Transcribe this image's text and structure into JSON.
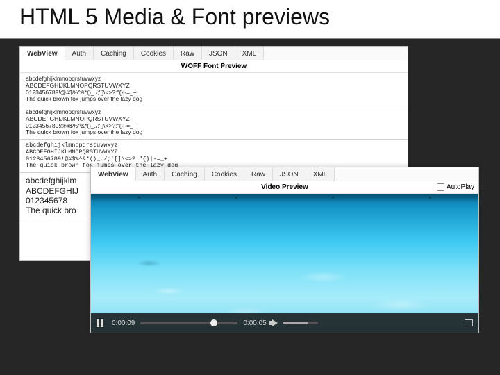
{
  "slide": {
    "title": "HTML 5 Media & Font previews"
  },
  "fontPanel": {
    "tabs": [
      "WebView",
      "Auth",
      "Caching",
      "Cookies",
      "Raw",
      "JSON",
      "XML"
    ],
    "activeTab": 0,
    "title": "WOFF Font Preview",
    "block": {
      "line1": "abcdefghijklmnopqrstuvwxyz",
      "line2": "ABCDEFGHIJKLMNOPQRSTUVWXYZ",
      "line3": "0123456789!@#$%^&*()_./;'[]\\<>?:\"{}|-=_+",
      "line4": "The quick brown fox jumps over the lazy dog"
    },
    "bigBlock": {
      "line1": "abcdefghijklm",
      "line2": "ABCDEFGHIJ",
      "line3": "012345678",
      "line4": "The quick bro"
    }
  },
  "videoPanel": {
    "tabs": [
      "WebView",
      "Auth",
      "Caching",
      "Cookies",
      "Raw",
      "JSON",
      "XML"
    ],
    "activeTab": 0,
    "title": "Video Preview",
    "autoplayLabel": "AutoPlay",
    "elapsed": "0:00:09",
    "remaining": "0:00:05"
  }
}
